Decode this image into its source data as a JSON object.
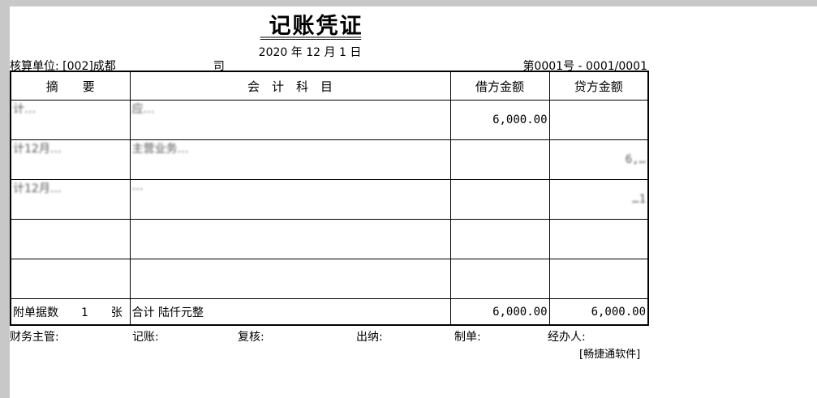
{
  "voucher": {
    "title": "记账凭证",
    "rule": "====================",
    "date_year": "2020",
    "date_month": "12",
    "date_day": "1",
    "year_label": "年",
    "month_label": "月",
    "day_label": "日",
    "unit_prefix": "核算单位: [002]成都",
    "unit_suffix": "司",
    "voucher_no": "第0001号 - 0001/0001"
  },
  "table": {
    "headers": {
      "summary": "摘　　要",
      "account": "会　计　科　目",
      "debit": "借方金额",
      "credit": "贷方金额"
    },
    "rows": [
      {
        "summary": "计…",
        "account": "应…",
        "debit": "6,000.00",
        "credit": ""
      },
      {
        "summary": "计12月…",
        "account": "主营业务…",
        "debit": "",
        "credit": "6,…"
      },
      {
        "summary": "计12月…",
        "account": "…",
        "debit": "",
        "credit": "…1"
      },
      {
        "summary": "",
        "account": "",
        "debit": "",
        "credit": ""
      },
      {
        "summary": "",
        "account": "",
        "debit": "",
        "credit": ""
      }
    ],
    "footer": {
      "attachments": "附单据数　　1　　张",
      "total_text": "合计 陆仟元整",
      "debit_total": "6,000.00",
      "credit_total": "6,000.00"
    }
  },
  "signatures": {
    "supervisor": "财务主管:",
    "bookkeeper": "记账:",
    "reviewer": "复核:",
    "cashier": "出纳:",
    "preparer": "制单:",
    "handler": "经办人:"
  },
  "software": "[畅捷通软件]"
}
